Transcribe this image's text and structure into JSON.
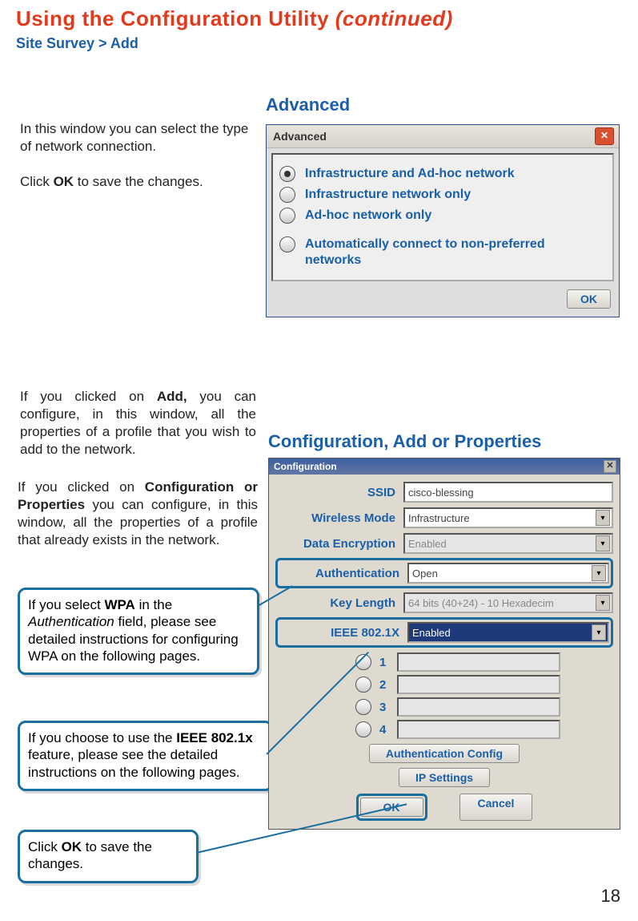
{
  "title_main": "Using the Configuration Utility ",
  "title_italic": "(continued)",
  "breadcrumb": "Site Survey > Add",
  "section_advanced_heading": "Advanced",
  "section_config_heading": "Configuration, Add or Properties",
  "text_block1_a": "In this window you can select the type of network connection.",
  "text_block1_b_pre": "Click ",
  "text_block1_b_bold": "OK",
  "text_block1_b_post": " to save the changes.",
  "text_block2_pre": "If you clicked on ",
  "text_block2_bold": "Add,",
  "text_block2_post": " you can configure, in this window, all the properties of a profile that you wish to add to the network.",
  "text_block3_pre": "If you clicked on ",
  "text_block3_bold": "Configuration or Properties",
  "text_block3_post": " you can configure, in this window, all the properties of a profile that already exists in the network.",
  "callout1_pre": "If you select ",
  "callout1_bold": "WPA",
  "callout1_mid": " in the ",
  "callout1_italic": "Authentication",
  "callout1_post": " field, please see detailed instructions for configuring WPA on the following pages.",
  "callout2_pre": "If you choose to use the ",
  "callout2_bold": "IEEE 802.1x",
  "callout2_post": " feature, please see the detailed instructions on the following pages.",
  "callout3_pre": "Click ",
  "callout3_bold": "OK",
  "callout3_post": " to save the changes.",
  "advanced": {
    "title": "Advanced",
    "options": [
      "Infrastructure and Ad-hoc network",
      "Infrastructure  network only",
      "Ad-hoc network only",
      "Automatically connect to non-preferred networks"
    ],
    "ok": "OK"
  },
  "config": {
    "title": "Configuration",
    "labels": {
      "ssid": "SSID",
      "mode": "Wireless Mode",
      "enc": "Data Encryption",
      "auth": "Authentication",
      "keylen": "Key Length",
      "ieee": "IEEE 802.1X"
    },
    "values": {
      "ssid": "cisco-blessing",
      "mode": "Infrastructure",
      "enc": "Enabled",
      "auth": "Open",
      "keylen": "64 bits (40+24) - 10 Hexadecim",
      "ieee": "Enabled"
    },
    "key_numbers": [
      "1",
      "2",
      "3",
      "4"
    ],
    "authconfig_btn": "Authentication Config",
    "ipsettings_btn": "IP Settings",
    "ok": "OK",
    "cancel": "Cancel"
  },
  "page_number": "18"
}
